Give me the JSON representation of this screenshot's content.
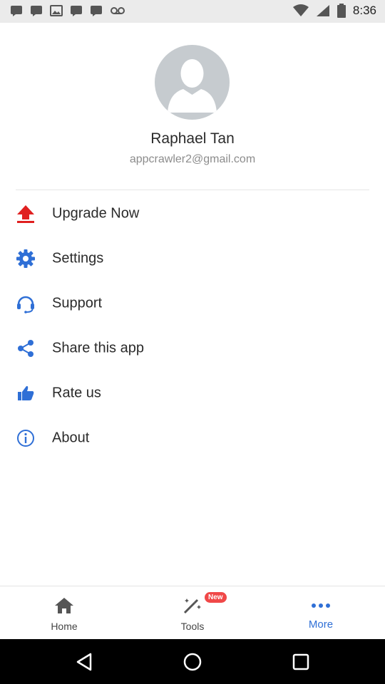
{
  "status_bar": {
    "time": "8:36",
    "left_icons": [
      "message-icon",
      "message-icon",
      "image-icon",
      "message-icon",
      "message-icon",
      "voicemail-icon"
    ],
    "right_icons": [
      "wifi-icon",
      "signal-icon",
      "battery-icon"
    ]
  },
  "profile": {
    "name": "Raphael Tan",
    "email": "appcrawler2@gmail.com",
    "avatar_icon": "person-placeholder-icon"
  },
  "menu": {
    "items": [
      {
        "label": "Upgrade Now",
        "icon": "upload-arrow-icon",
        "color": "#e02020"
      },
      {
        "label": "Settings",
        "icon": "gear-icon",
        "color": "#2f6fd6"
      },
      {
        "label": "Support",
        "icon": "headset-icon",
        "color": "#2f6fd6"
      },
      {
        "label": "Share this app",
        "icon": "share-icon",
        "color": "#2f6fd6"
      },
      {
        "label": "Rate us",
        "icon": "thumbs-up-icon",
        "color": "#2f6fd6"
      },
      {
        "label": "About",
        "icon": "info-icon",
        "color": "#2f6fd6"
      }
    ]
  },
  "bottom_nav": {
    "home_label": "Home",
    "tools_label": "Tools",
    "tools_badge": "New",
    "more_label": "More",
    "active_tab": "More",
    "accent_color": "#2f6fd6"
  },
  "system_nav": {
    "buttons": [
      "back-icon",
      "home-circle-icon",
      "recents-icon"
    ]
  }
}
